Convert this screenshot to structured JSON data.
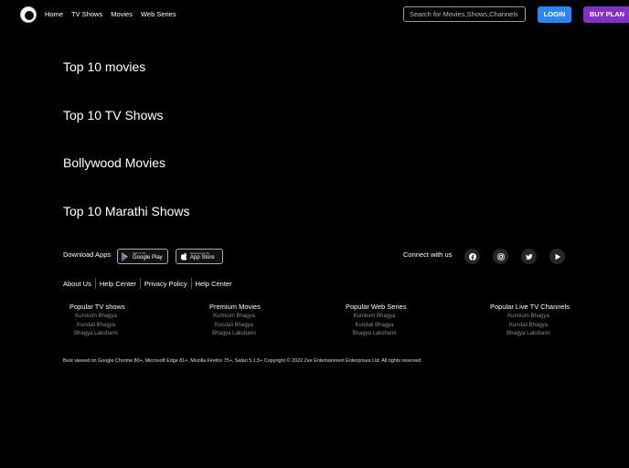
{
  "header": {
    "nav": [
      "Home",
      "TV Shows",
      "Movies",
      "Web Series"
    ],
    "search_placeholder": "Search for Movies,Shows,Channels e",
    "login_label": "LOGIN",
    "buy_label": "BUY PLAN"
  },
  "sections": [
    "Top 10 movies",
    "Top 10 TV Shows",
    "Bollywood Movies",
    "Top 10 Marathi Shows"
  ],
  "apps": {
    "label": "Download Apps",
    "google_play": {
      "sub": "GET IT ON",
      "main": "Google Play"
    },
    "app_store": {
      "sub": "Download on the",
      "main": "App Store"
    }
  },
  "connect": {
    "label": "Connect with us",
    "icons": [
      "facebook-icon",
      "instagram-icon",
      "twitter-icon",
      "youtube-icon"
    ]
  },
  "footer_links": [
    "About Us",
    "Help Center",
    "Privacy Policy",
    "Help Center"
  ],
  "footer_columns": [
    {
      "title": "Popular TV shows",
      "items": [
        "Kumkum Bhagya",
        "Kundali Bhagya",
        "Bhagya Lakshami"
      ]
    },
    {
      "title": "Premium Movies",
      "items": [
        "Kumkum Bhagya",
        "Kundali Bhagya",
        "Bhagya Lakshami"
      ]
    },
    {
      "title": "Popular Web Series",
      "items": [
        "Kumkum Bhagya",
        "Kundali Bhagya",
        "Bhagya Lakshami"
      ]
    },
    {
      "title": "Popular Live TV Channels",
      "items": [
        "Kumkum Bhagya",
        "Kundali Bhagya",
        "Bhagya Lakshami"
      ]
    }
  ],
  "copyright": "Best viewed on Google Chrome 80+, Microsoft Edge 81+, Mozilla Firefox 75+, Safari 5.1.5+ Copyright © 2022 Zee Entertainment Enterprises Ltd. All rights reserved.",
  "colors": {
    "login": "#2e86f2",
    "buy_plan": "#8230c6",
    "background": "#000000"
  }
}
